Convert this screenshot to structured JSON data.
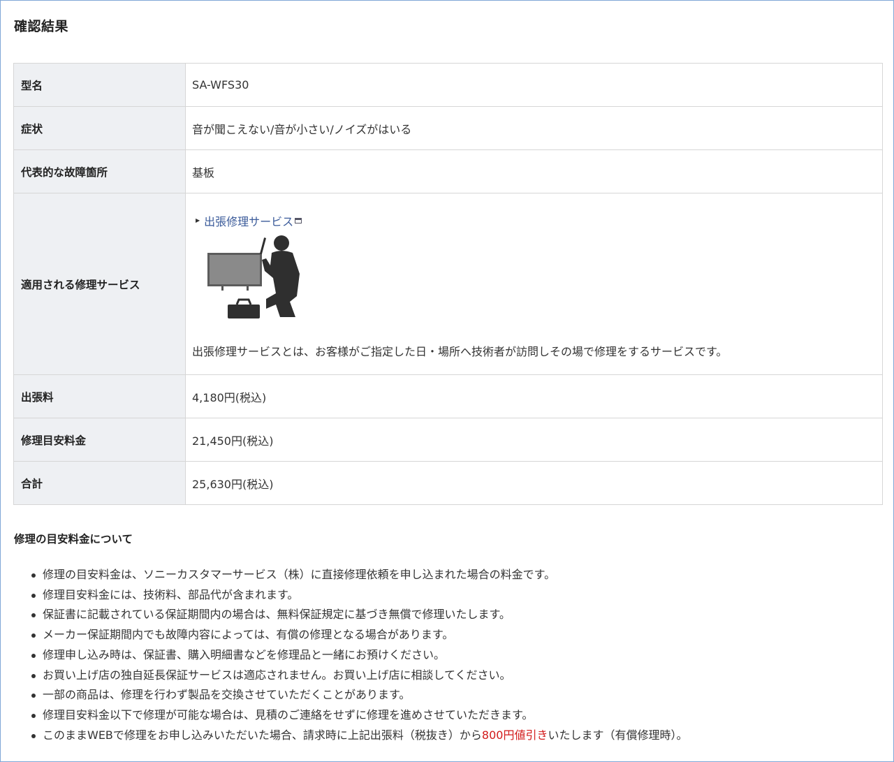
{
  "page": {
    "title": "確認結果"
  },
  "table": {
    "rows": [
      {
        "label": "型名",
        "value": "SA-WFS30"
      },
      {
        "label": "症状",
        "value": "音が聞こえない/音が小さい/ノイズがはいる"
      },
      {
        "label": "代表的な故障箇所",
        "value": "基板"
      },
      {
        "label": "適用される修理サービス",
        "link": "出張修理サービス",
        "description": "出張修理サービスとは、お客様がご指定した日・場所へ技術者が訪問しその場で修理をするサービスです。"
      },
      {
        "label": "出張料",
        "value": "4,180円(税込)"
      },
      {
        "label": "修理目安料金",
        "value": "21,450円(税込)"
      },
      {
        "label": "合計",
        "value": "25,630円(税込)"
      }
    ]
  },
  "notes": {
    "title": "修理の目安料金について",
    "items": [
      "修理の目安料金は、ソニーカスタマーサービス（株）に直接修理依頼を申し込まれた場合の料金です。",
      "修理目安料金には、技術料、部品代が含まれます。",
      "保証書に記載されている保証期間内の場合は、無料保証規定に基づき無償で修理いたします。",
      "メーカー保証期間内でも故障内容によっては、有償の修理となる場合があります。",
      "修理申し込み時は、保証書、購入明細書などを修理品と一緒にお預けください。",
      "お買い上げ店の独自延長保証サービスは適応されません。お買い上げ店に相談してください。",
      "一部の商品は、修理を行わず製品を交換させていただくことがあります。",
      "修理目安料金以下で修理が可能な場合は、見積のご連絡をせずに修理を進めさせていただきます。"
    ],
    "last_item": {
      "before": "このままWEBで修理をお申し込みいただいた場合、請求時に上記出張料（税抜き）から",
      "highlight": "800円値引き",
      "after": "いたします（有償修理時）。"
    }
  },
  "colors": {
    "accent_red": "#d21a1a",
    "link": "#3b5b9a",
    "header_bg": "#eef0f3",
    "frame_border": "#7fa7d6"
  },
  "icons": {
    "external": "external-window-icon",
    "illustration": "technician-tv-illustration"
  }
}
